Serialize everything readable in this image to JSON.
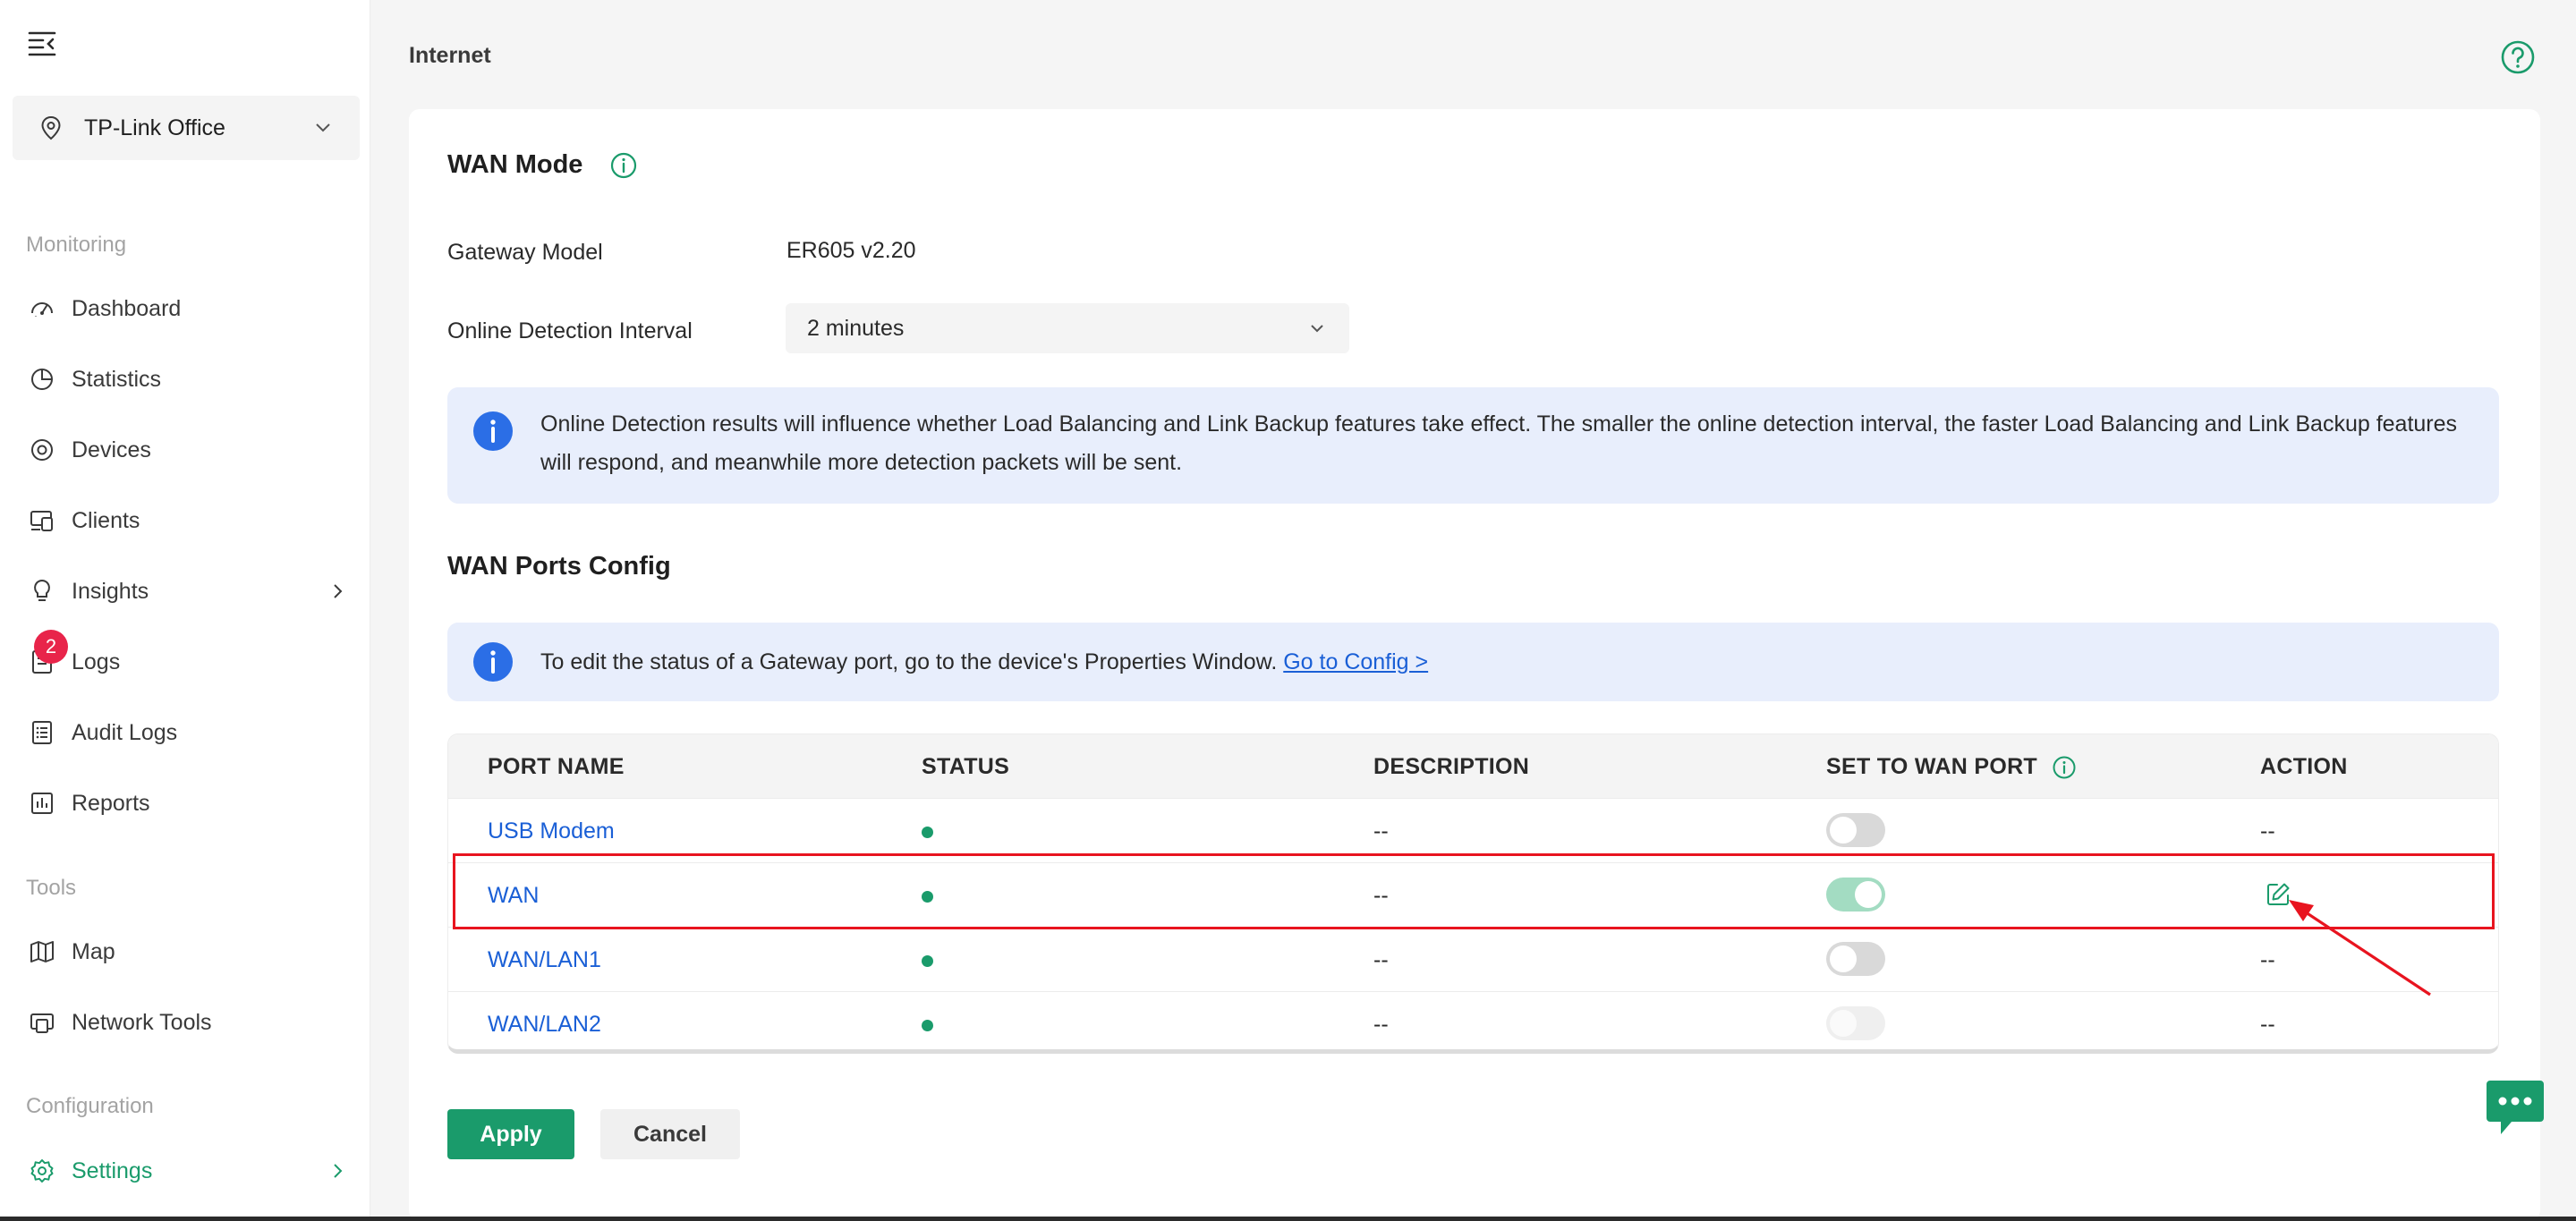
{
  "colors": {
    "accent": "#1a9b6b",
    "link": "#1a5fd6",
    "badge": "#e8244a",
    "highlight": "#e8141f",
    "notice_bg": "#e8eefc"
  },
  "sidebar": {
    "site": "TP-Link Office",
    "sections": {
      "monitoring": "Monitoring",
      "tools": "Tools",
      "configuration": "Configuration"
    },
    "items": {
      "dashboard": "Dashboard",
      "statistics": "Statistics",
      "devices": "Devices",
      "clients": "Clients",
      "insights": "Insights",
      "logs": "Logs",
      "logs_badge": "2",
      "audit_logs": "Audit Logs",
      "reports": "Reports",
      "map": "Map",
      "network_tools": "Network Tools",
      "settings": "Settings"
    }
  },
  "header": {
    "title": "Internet"
  },
  "wan_mode": {
    "heading": "WAN Mode",
    "gateway_model_label": "Gateway Model",
    "gateway_model_value": "ER605 v2.20",
    "interval_label": "Online Detection Interval",
    "interval_value": "2 minutes",
    "notice": "Online Detection results will influence whether Load Balancing and Link Backup features take effect. The smaller the online detection interval, the faster Load Balancing and Link Backup features will respond, and meanwhile more detection packets will be sent."
  },
  "wan_ports": {
    "heading": "WAN Ports Config",
    "notice": "To edit the status of a Gateway port, go to the device's Properties Window.",
    "notice_link": "Go to Config >",
    "columns": {
      "port_name": "PORT NAME",
      "status": "STATUS",
      "description": "DESCRIPTION",
      "set_to_wan": "SET TO WAN PORT",
      "action": "ACTION"
    },
    "rows": [
      {
        "port": "USB Modem",
        "description": "--",
        "wan": "off",
        "action": "--"
      },
      {
        "port": "WAN",
        "description": "--",
        "wan": "on",
        "action": "edit"
      },
      {
        "port": "WAN/LAN1",
        "description": "--",
        "wan": "off",
        "action": "--"
      },
      {
        "port": "WAN/LAN2",
        "description": "--",
        "wan": "disabled",
        "action": "--"
      }
    ]
  },
  "buttons": {
    "apply": "Apply",
    "cancel": "Cancel"
  },
  "icons": [
    "menu-collapse-icon",
    "location-pin-icon",
    "chevron-down-icon",
    "dashboard-icon",
    "statistics-icon",
    "devices-icon",
    "clients-icon",
    "insights-icon",
    "logs-icon",
    "audit-logs-icon",
    "reports-icon",
    "map-icon",
    "network-tools-icon",
    "settings-icon",
    "help-icon",
    "info-icon",
    "edit-icon",
    "chat-icon"
  ]
}
